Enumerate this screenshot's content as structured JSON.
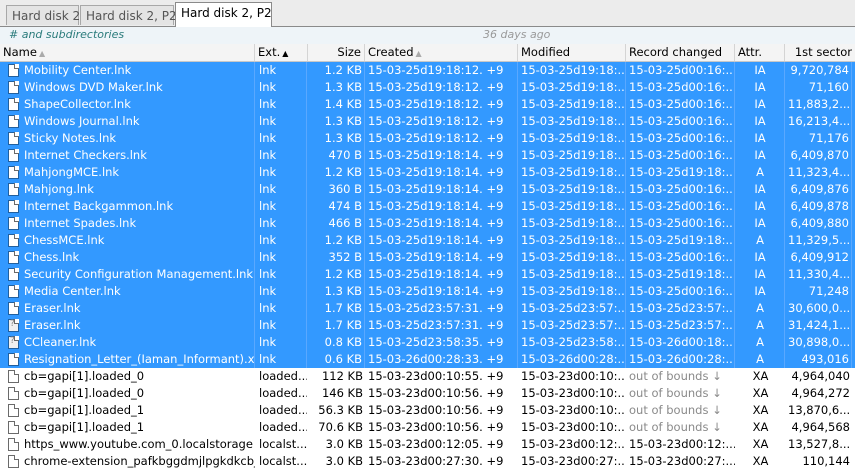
{
  "tabs": [
    {
      "label": "Hard disk 2"
    },
    {
      "label": "Hard disk 2, P2"
    },
    {
      "label": "Hard disk 2, P2"
    }
  ],
  "infobar": {
    "scope": "# and subdirectories",
    "age": "36 days ago"
  },
  "columns": {
    "name": "Name",
    "ext": "Ext.",
    "size": "Size",
    "created": "Created",
    "modified": "Modified",
    "record_changed": "Record changed",
    "attr": "Attr.",
    "first_sector": "1st sector"
  },
  "colors": {
    "selection": "#3399ff",
    "scope_text": "#2a7b7b"
  },
  "files": [
    {
      "name": "Mobility Center.lnk",
      "ext": "lnk",
      "size": "1.2 KB",
      "created": "15-03-25d19:18:12. +9",
      "modified": "15-03-25d19:18:...",
      "record_changed": "15-03-25d00:16:...",
      "attr": "IA",
      "sector": "9,720,784"
    },
    {
      "name": "Windows DVD Maker.lnk",
      "ext": "lnk",
      "size": "1.3 KB",
      "created": "15-03-25d19:18:12. +9",
      "modified": "15-03-25d19:18:...",
      "record_changed": "15-03-25d00:16:...",
      "attr": "IA",
      "sector": "71,160"
    },
    {
      "name": "ShapeCollector.lnk",
      "ext": "lnk",
      "size": "1.4 KB",
      "created": "15-03-25d19:18:12. +9",
      "modified": "15-03-25d19:18:...",
      "record_changed": "15-03-25d00:16:...",
      "attr": "IA",
      "sector": "11,883,2..."
    },
    {
      "name": "Windows Journal.lnk",
      "ext": "lnk",
      "size": "1.3 KB",
      "created": "15-03-25d19:18:12. +9",
      "modified": "15-03-25d19:18:...",
      "record_changed": "15-03-25d00:16:...",
      "attr": "IA",
      "sector": "16,213,4..."
    },
    {
      "name": "Sticky Notes.lnk",
      "ext": "lnk",
      "size": "1.3 KB",
      "created": "15-03-25d19:18:12. +9",
      "modified": "15-03-25d19:18:...",
      "record_changed": "15-03-25d00:16:...",
      "attr": "IA",
      "sector": "71,176"
    },
    {
      "name": "Internet Checkers.lnk",
      "ext": "lnk",
      "size": "470 B",
      "created": "15-03-25d19:18:14. +9",
      "modified": "15-03-25d19:18:...",
      "record_changed": "15-03-25d00:16:...",
      "attr": "IA",
      "sector": "6,409,870"
    },
    {
      "name": "MahjongMCE.lnk",
      "ext": "lnk",
      "size": "1.2 KB",
      "created": "15-03-25d19:18:14. +9",
      "modified": "15-03-25d19:18:...",
      "record_changed": "15-03-25d19:18:...",
      "attr": "A",
      "sector": "11,323,4..."
    },
    {
      "name": "Mahjong.lnk",
      "ext": "lnk",
      "size": "360 B",
      "created": "15-03-25d19:18:14. +9",
      "modified": "15-03-25d19:18:...",
      "record_changed": "15-03-25d00:16:...",
      "attr": "IA",
      "sector": "6,409,876"
    },
    {
      "name": "Internet Backgammon.lnk",
      "ext": "lnk",
      "size": "474 B",
      "created": "15-03-25d19:18:14. +9",
      "modified": "15-03-25d19:18:...",
      "record_changed": "15-03-25d00:16:...",
      "attr": "IA",
      "sector": "6,409,878"
    },
    {
      "name": "Internet Spades.lnk",
      "ext": "lnk",
      "size": "466 B",
      "created": "15-03-25d19:18:14. +9",
      "modified": "15-03-25d19:18:...",
      "record_changed": "15-03-25d00:16:...",
      "attr": "IA",
      "sector": "6,409,880"
    },
    {
      "name": "ChessMCE.lnk",
      "ext": "lnk",
      "size": "1.2 KB",
      "created": "15-03-25d19:18:14. +9",
      "modified": "15-03-25d19:18:...",
      "record_changed": "15-03-25d19:18:...",
      "attr": "A",
      "sector": "11,329,5..."
    },
    {
      "name": "Chess.lnk",
      "ext": "lnk",
      "size": "352 B",
      "created": "15-03-25d19:18:14. +9",
      "modified": "15-03-25d19:18:...",
      "record_changed": "15-03-25d00:16:...",
      "attr": "IA",
      "sector": "6,409,912"
    },
    {
      "name": "Security Configuration Management.lnk",
      "ext": "lnk",
      "size": "1.2 KB",
      "created": "15-03-25d19:18:14. +9",
      "modified": "15-03-25d19:18:...",
      "record_changed": "15-03-25d19:18:...",
      "attr": "IA",
      "sector": "11,330,4..."
    },
    {
      "name": "Media Center.lnk",
      "ext": "lnk",
      "size": "1.3 KB",
      "created": "15-03-25d19:18:14. +9",
      "modified": "15-03-25d19:18:...",
      "record_changed": "15-03-25d00:16:...",
      "attr": "IA",
      "sector": "71,248"
    },
    {
      "name": "Eraser.lnk",
      "ext": "lnk",
      "size": "1.7 KB",
      "created": "15-03-25d23:57:31. +9",
      "modified": "15-03-25d23:57:...",
      "record_changed": "15-03-25d23:57:...",
      "attr": "A",
      "sector": "30,600,0..."
    },
    {
      "name": "Eraser.lnk",
      "ext": "lnk",
      "size": "1.7 KB",
      "created": "15-03-25d23:57:31. +9",
      "modified": "15-03-25d23:57:...",
      "record_changed": "15-03-25d23:57:...",
      "attr": "A",
      "sector": "31,424,1...",
      "deleted": true
    },
    {
      "name": "CCleaner.lnk",
      "ext": "lnk",
      "size": "0.8 KB",
      "created": "15-03-25d23:58:35. +9",
      "modified": "15-03-25d23:58:...",
      "record_changed": "15-03-26d00:18:...",
      "attr": "A",
      "sector": "30,898,0...",
      "deleted": true
    },
    {
      "name": "Resignation_Letter_(Iaman_Informant).xps...",
      "ext": "lnk",
      "size": "0.6 KB",
      "created": "15-03-26d00:28:33. +9",
      "modified": "15-03-26d00:28:...",
      "record_changed": "15-03-26d00:28:...",
      "attr": "A",
      "sector": "493,016"
    }
  ],
  "others": [
    {
      "name": "cb=gapi[1].loaded_0",
      "ext": "loaded...",
      "size": "112 KB",
      "created": "15-03-23d00:10:55. +9",
      "modified": "15-03-23d00:10:...",
      "record_changed": "out of bounds ↓",
      "attr": "XA",
      "sector": "4,964,040"
    },
    {
      "name": "cb=gapi[1].loaded_0",
      "ext": "loaded...",
      "size": "146 KB",
      "created": "15-03-23d00:10:56. +9",
      "modified": "15-03-23d00:10:...",
      "record_changed": "out of bounds ↓",
      "attr": "XA",
      "sector": "4,964,272"
    },
    {
      "name": "cb=gapi[1].loaded_1",
      "ext": "loaded...",
      "size": "56.3 KB",
      "created": "15-03-23d00:10:56. +9",
      "modified": "15-03-23d00:10:...",
      "record_changed": "out of bounds ↓",
      "attr": "XA",
      "sector": "13,870,6..."
    },
    {
      "name": "cb=gapi[1].loaded_1",
      "ext": "loaded...",
      "size": "70.6 KB",
      "created": "15-03-23d00:10:56. +9",
      "modified": "15-03-23d00:10:...",
      "record_changed": "out of bounds ↓",
      "attr": "XA",
      "sector": "4,964,568"
    },
    {
      "name": "https_www.youtube.com_0.localstorage",
      "ext": "localst...",
      "size": "3.0 KB",
      "created": "15-03-23d00:12:05. +9",
      "modified": "15-03-23d00:12:...",
      "record_changed": "15-03-23d00:12:...",
      "attr": "XA",
      "sector": "13,527,8..."
    },
    {
      "name": "chrome-extension_pafkbggdmjlpgkdkcbj...",
      "ext": "localst...",
      "size": "3.0 KB",
      "created": "15-03-23d00:27:30. +9",
      "modified": "15-03-23d00:27:...",
      "record_changed": "15-03-23d00:27:...",
      "attr": "XA",
      "sector": "110,144"
    }
  ]
}
